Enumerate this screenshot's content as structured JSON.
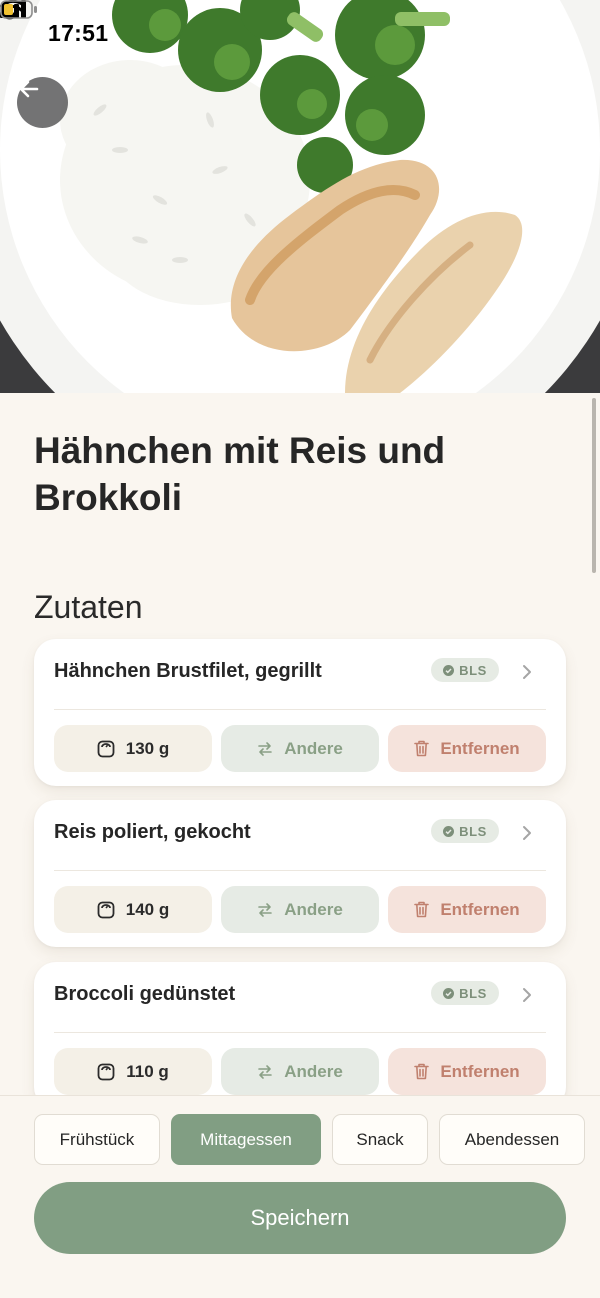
{
  "status_bar": {
    "time": "17:51"
  },
  "recipe": {
    "title": "Hähnchen mit Reis und Brokkoli"
  },
  "ingredients_section": {
    "title": "Zutaten",
    "items": [
      {
        "name": "Hähnchen Brustfilet, gegrillt",
        "badge": "BLS",
        "amount": "130 g",
        "other_label": "Andere",
        "remove_label": "Entfernen"
      },
      {
        "name": "Reis poliert, gekocht",
        "badge": "BLS",
        "amount": "140 g",
        "other_label": "Andere",
        "remove_label": "Entfernen"
      },
      {
        "name": "Broccoli gedünstet",
        "badge": "BLS",
        "amount": "110 g",
        "other_label": "Andere",
        "remove_label": "Entfernen"
      }
    ]
  },
  "meal_tabs": {
    "items": [
      "Frühstück",
      "Mittagessen",
      "Snack",
      "Abendessen"
    ],
    "selected": "Mittagessen"
  },
  "save_label": "Speichern",
  "colors": {
    "accent": "#819e83",
    "background": "#faf6f0",
    "badge_text": "#7d8f7a",
    "remove_text": "#c0806e"
  }
}
